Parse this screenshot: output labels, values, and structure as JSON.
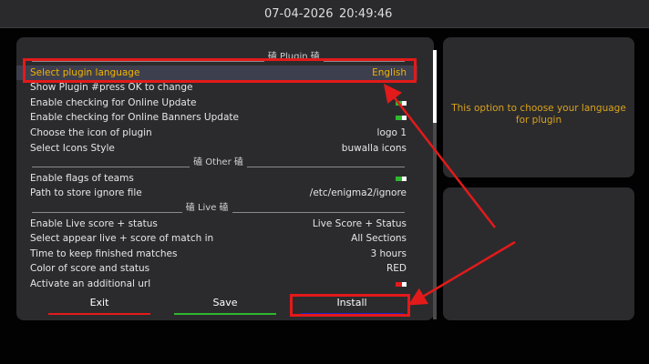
{
  "header": {
    "date": "07-04-2026",
    "time": "20:49:46"
  },
  "sections": {
    "plugin": "Plugin",
    "other": "Other",
    "live": "Live"
  },
  "settings": [
    {
      "label": "Select plugin language",
      "value": "English"
    },
    {
      "label": "Show Plugin #press OK to change",
      "value": ""
    },
    {
      "label": "Enable checking for Online Update",
      "value": "on"
    },
    {
      "label": "Enable checking for Online Banners Update",
      "value": "on"
    },
    {
      "label": "Choose the icon of plugin",
      "value": "logo 1"
    },
    {
      "label": "Select Icons Style",
      "value": "buwalla icons"
    },
    {
      "label": "Enable flags of teams",
      "value": "on"
    },
    {
      "label": "Path to store ignore file",
      "value": "/etc/enigma2/ignore"
    },
    {
      "label": "Enable Live score + status",
      "value": "Live Score + Status"
    },
    {
      "label": "Select appear live + score of match in",
      "value": "All Sections"
    },
    {
      "label": "Time to keep finished matches",
      "value": "3 hours"
    },
    {
      "label": "Color of score and status",
      "value": "RED"
    },
    {
      "label": "Activate an additional url",
      "value": "off"
    }
  ],
  "buttons": {
    "exit": "Exit",
    "save": "Save",
    "install": "Install"
  },
  "info": {
    "description": "This option to choose your language for plugin"
  },
  "colors": {
    "accent": "#f0b400",
    "toggle_on": "#2eb82e",
    "toggle_off": "#e31a1a",
    "exit": "#e31a1a",
    "save": "#2eb82e",
    "install": "#2222cc",
    "annotation": "#e31a1a"
  }
}
